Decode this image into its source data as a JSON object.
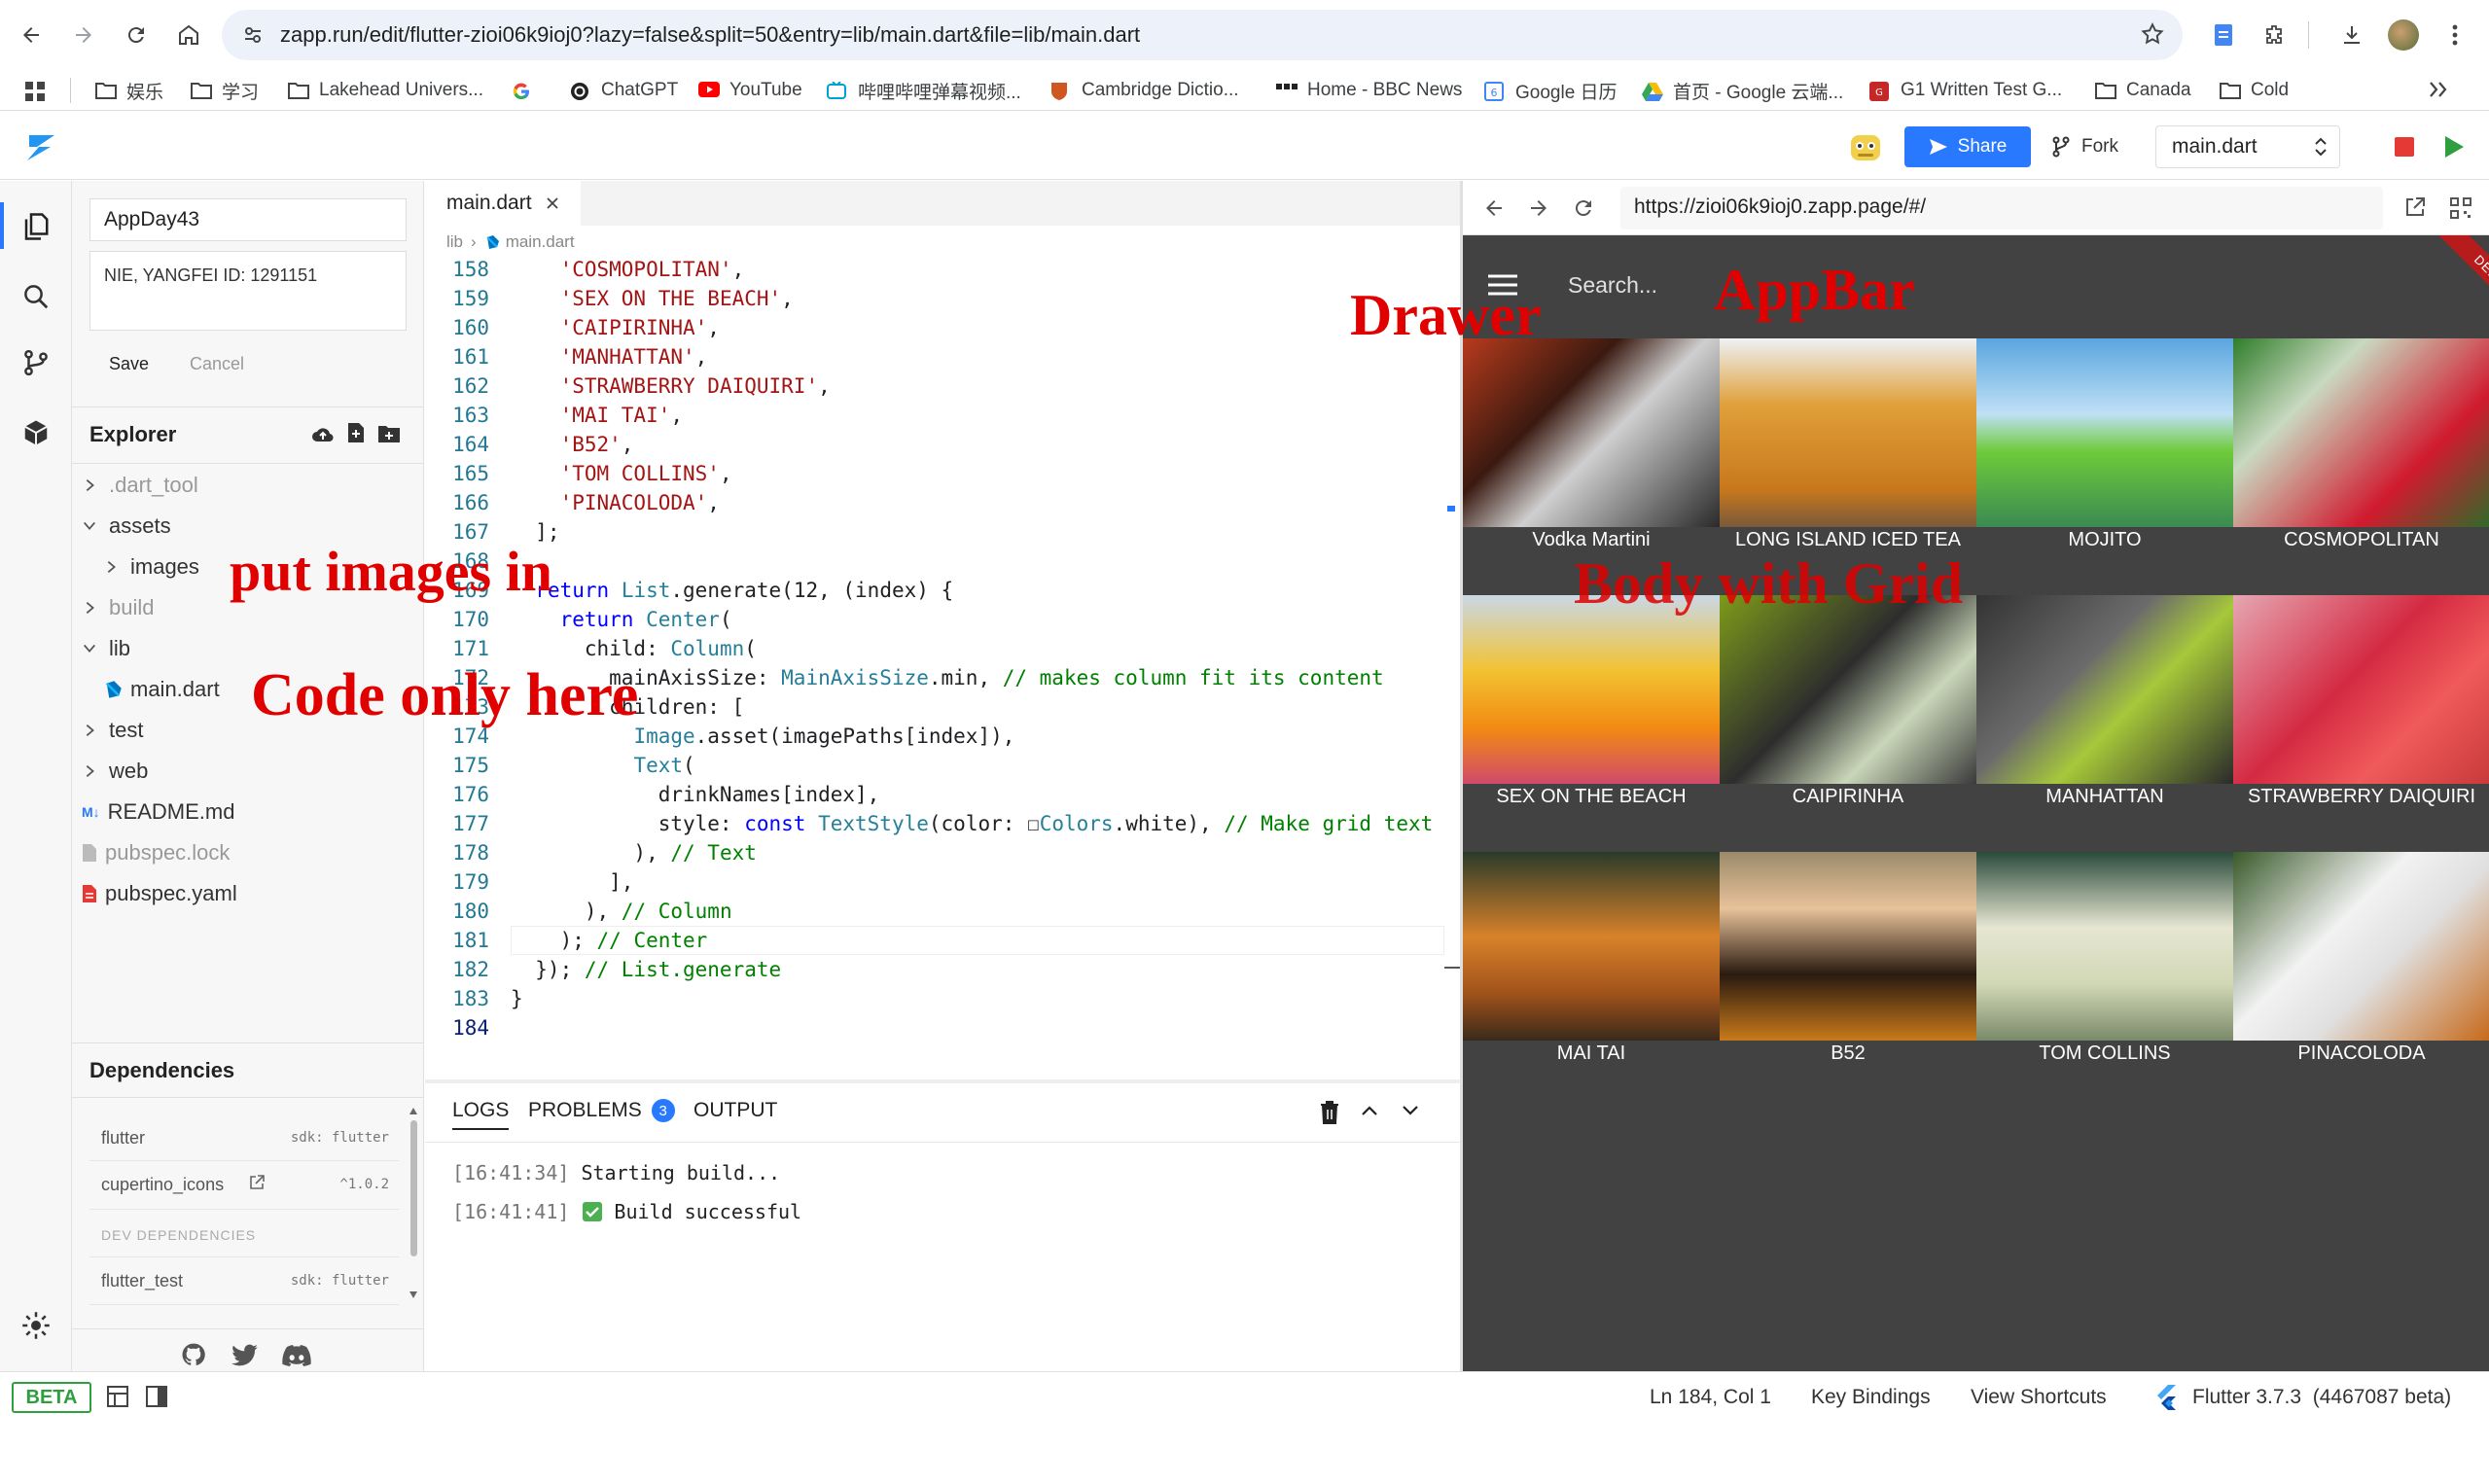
{
  "browser": {
    "url": "zapp.run/edit/flutter-zioi06k9ioj0?lazy=false&split=50&entry=lib/main.dart&file=lib/main.dart",
    "bookmarks": [
      "娱乐",
      "学习",
      "Lakehead Univers...",
      "ChatGPT",
      "YouTube",
      "哔哩哔哩弹幕视频...",
      "Cambridge Dictio...",
      "Home - BBC News",
      "Google 日历",
      "首页 - Google 云端...",
      "G1 Written Test G...",
      "Canada",
      "Cold"
    ]
  },
  "header": {
    "share_label": "Share",
    "fork_label": "Fork",
    "file_select": "main.dart"
  },
  "sidepanel": {
    "project_name": "AppDay43",
    "description": "NIE, YANGFEI ID: 1291151",
    "save_label": "Save",
    "cancel_label": "Cancel",
    "explorer_title": "Explorer",
    "tree": [
      {
        "label": ".dart_tool",
        "type": "folder",
        "expanded": false,
        "muted": true
      },
      {
        "label": "assets",
        "type": "folder",
        "expanded": true
      },
      {
        "label": "images",
        "type": "folder",
        "expanded": false
      },
      {
        "label": "build",
        "type": "folder",
        "expanded": false,
        "muted": true
      },
      {
        "label": "lib",
        "type": "folder",
        "expanded": true
      },
      {
        "label": "main.dart",
        "type": "dart"
      },
      {
        "label": "test",
        "type": "folder",
        "expanded": false
      },
      {
        "label": "web",
        "type": "folder",
        "expanded": false
      },
      {
        "label": "README.md",
        "type": "md"
      },
      {
        "label": "pubspec.lock",
        "type": "lock",
        "muted": true
      },
      {
        "label": "pubspec.yaml",
        "type": "yaml"
      }
    ],
    "deps_title": "Dependencies",
    "deps": [
      {
        "name": "flutter",
        "version": "sdk: flutter"
      },
      {
        "name": "cupertino_icons",
        "version": "^1.0.2"
      }
    ],
    "dev_deps_title": "DEV DEPENDENCIES",
    "dev_deps": [
      {
        "name": "flutter_test",
        "version": "sdk: flutter"
      }
    ]
  },
  "editor": {
    "tab": "main.dart",
    "breadcrumb_root": "lib",
    "breadcrumb_file": "main.dart",
    "lines": [
      {
        "n": "158",
        "code": "    'COSMOPOLITAN',"
      },
      {
        "n": "159",
        "code": "    'SEX ON THE BEACH',"
      },
      {
        "n": "160",
        "code": "    'CAIPIRINHA',"
      },
      {
        "n": "161",
        "code": "    'MANHATTAN',"
      },
      {
        "n": "162",
        "code": "    'STRAWBERRY DAIQUIRI',"
      },
      {
        "n": "163",
        "code": "    'MAI TAI',"
      },
      {
        "n": "164",
        "code": "    'B52',"
      },
      {
        "n": "165",
        "code": "    'TOM COLLINS',"
      },
      {
        "n": "166",
        "code": "    'PINACOLODA',"
      },
      {
        "n": "167",
        "code": "  ];"
      },
      {
        "n": "168",
        "code": ""
      },
      {
        "n": "169",
        "code": "  return List.generate(12, (index) {"
      },
      {
        "n": "170",
        "code": "    return Center("
      },
      {
        "n": "171",
        "code": "      child: Column("
      },
      {
        "n": "172",
        "code": "        mainAxisSize: MainAxisSize.min, // makes column fit its content"
      },
      {
        "n": "173",
        "code": "        children: ["
      },
      {
        "n": "174",
        "code": "          Image.asset(imagePaths[index]),"
      },
      {
        "n": "175",
        "code": "          Text("
      },
      {
        "n": "176",
        "code": "            drinkNames[index],"
      },
      {
        "n": "177",
        "code": "            style: const TextStyle(color: ☐Colors.white), // Make grid text"
      },
      {
        "n": "178",
        "code": "          ), // Text"
      },
      {
        "n": "179",
        "code": "        ],"
      },
      {
        "n": "180",
        "code": "      ), // Column"
      },
      {
        "n": "181",
        "code": "    ); // Center"
      },
      {
        "n": "182",
        "code": "  }); // List.generate"
      },
      {
        "n": "183",
        "code": "}"
      },
      {
        "n": "184",
        "code": ""
      }
    ]
  },
  "output": {
    "tabs": [
      "LOGS",
      "PROBLEMS",
      "OUTPUT"
    ],
    "problems_count": "3",
    "logs": [
      {
        "time": "[16:41:34]",
        "msg": "Starting build..."
      },
      {
        "time": "[16:41:41]",
        "msg": "Build successful"
      }
    ]
  },
  "preview": {
    "url": "https://zioi06k9ioj0.zapp.page/#/",
    "search_placeholder": "Search...",
    "debug_banner": "DEBUG",
    "drinks": [
      "Vodka Martini",
      "LONG ISLAND ICED TEA",
      "MOJITO",
      "COSMOPOLITAN",
      "SEX ON THE BEACH",
      "CAIPIRINHA",
      "MANHATTAN",
      "STRAWBERRY DAIQUIRI",
      "MAI TAI",
      "B52",
      "TOM COLLINS",
      "PINACOLODA"
    ]
  },
  "annotations": {
    "drawer": "Drawer",
    "appbar": "AppBar",
    "body": "Body with Grid",
    "images": "put images in",
    "code": "Code only here"
  },
  "status": {
    "beta": "BETA",
    "position": "Ln 184, Col 1",
    "key_bindings": "Key Bindings",
    "view_shortcuts": "View Shortcuts",
    "flutter_version": "Flutter 3.7.3  (4467087 beta)"
  },
  "colors": {
    "accent_blue": "#1a73e8",
    "preview_bg": "#424242",
    "annotation_red": "#e00000"
  }
}
